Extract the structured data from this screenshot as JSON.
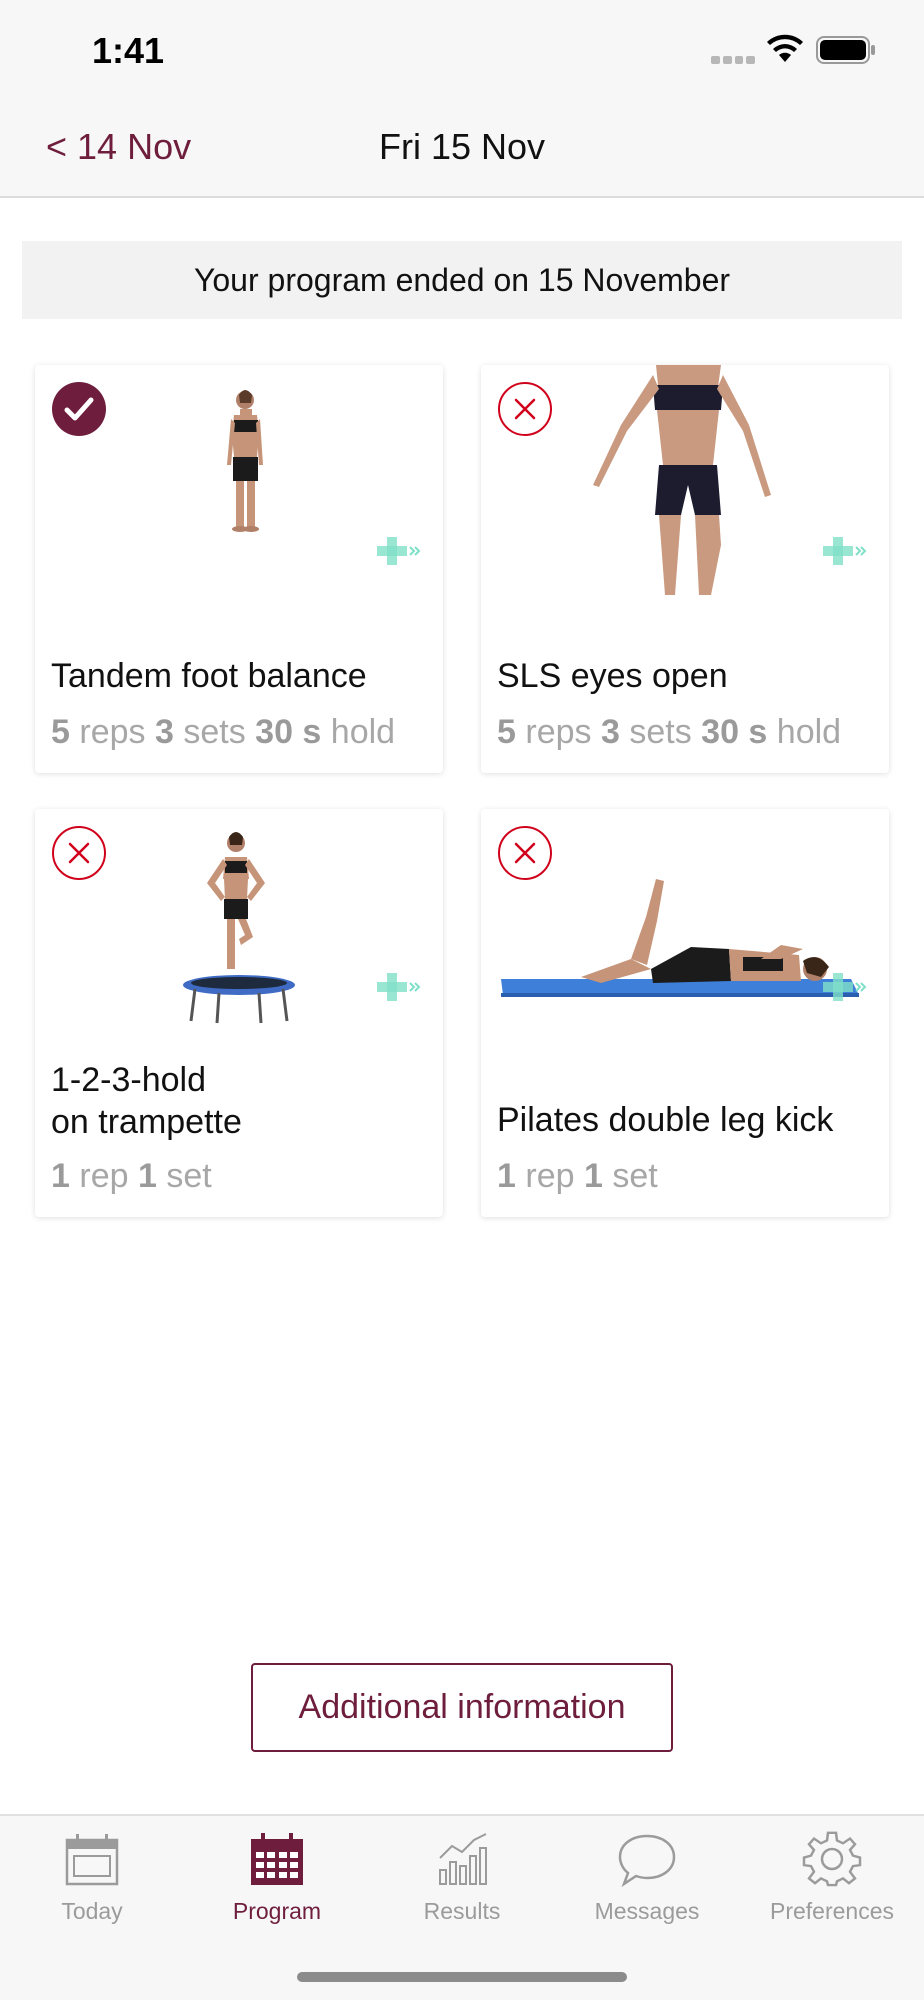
{
  "status_bar": {
    "time": "1:41"
  },
  "nav": {
    "back_label": "< 14 Nov",
    "title": "Fri 15 Nov"
  },
  "banner": {
    "text": "Your program ended on 15 November"
  },
  "exercises": [
    {
      "title": "Tandem foot balance",
      "status": "completed",
      "reps": "5",
      "reps_unit": "reps",
      "sets": "3",
      "sets_unit": "sets",
      "hold": "30 s",
      "hold_unit": "hold"
    },
    {
      "title": "SLS eyes open",
      "status": "missed",
      "reps": "5",
      "reps_unit": "reps",
      "sets": "3",
      "sets_unit": "sets",
      "hold": "30 s",
      "hold_unit": "hold"
    },
    {
      "title_line1": "1-2-3-hold",
      "title_line2": "on trampette",
      "status": "missed",
      "reps": "1",
      "reps_unit": "rep",
      "sets": "1",
      "sets_unit": "set"
    },
    {
      "title": "Pilates double leg kick",
      "status": "missed",
      "reps": "1",
      "reps_unit": "rep",
      "sets": "1",
      "sets_unit": "set"
    }
  ],
  "additional_button": "Additional information",
  "tabs": [
    {
      "label": "Today",
      "icon": "calendar-icon",
      "active": false
    },
    {
      "label": "Program",
      "icon": "calendar-grid-icon",
      "active": true
    },
    {
      "label": "Results",
      "icon": "chart-icon",
      "active": false
    },
    {
      "label": "Messages",
      "icon": "speech-bubble-icon",
      "active": false
    },
    {
      "label": "Preferences",
      "icon": "gear-icon",
      "active": false
    }
  ],
  "colors": {
    "accent": "#6e1e3c",
    "missed": "#d0021b",
    "plus": "#7fe0c8",
    "muted": "#9b9b9b"
  }
}
